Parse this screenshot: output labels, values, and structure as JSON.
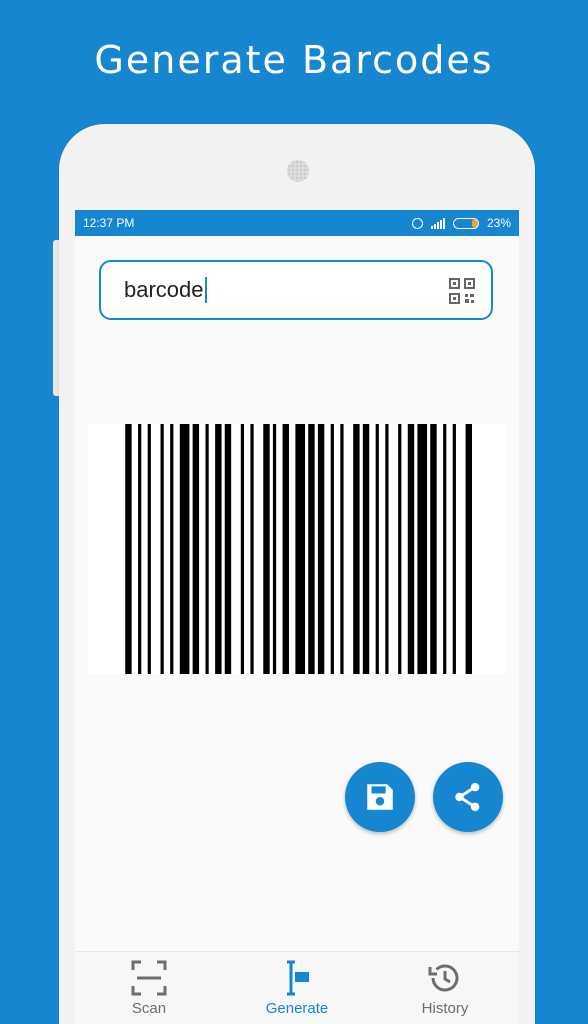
{
  "headline": "Generate Barcodes",
  "status_bar": {
    "time": "12:37 PM",
    "battery_percent": "23%",
    "battery_level": 0.23
  },
  "input": {
    "value": "barcode"
  },
  "icons": {
    "qr": "qr-code-icon",
    "save": "save-icon",
    "share": "share-icon",
    "scan": "scan-icon",
    "generate": "generate-icon",
    "history": "history-icon"
  },
  "barcode": {
    "pattern": [
      0,
      1,
      0,
      1,
      0,
      1,
      0,
      1,
      0,
      2,
      0,
      1,
      0,
      1,
      0,
      1,
      0,
      1,
      0,
      1,
      0,
      2,
      0,
      2,
      0,
      1,
      0,
      1,
      0,
      1,
      0,
      2,
      0,
      1,
      0,
      1,
      0,
      1,
      0,
      1,
      0,
      2,
      0,
      1,
      0,
      1,
      0,
      1,
      0,
      1,
      0,
      1,
      0,
      2,
      0,
      1,
      0,
      1,
      0,
      1,
      0,
      1
    ]
  },
  "nav": {
    "scan": "Scan",
    "generate": "Generate",
    "history": "History"
  },
  "colors": {
    "primary": "#1786d1",
    "battery": "#f4a52c"
  }
}
